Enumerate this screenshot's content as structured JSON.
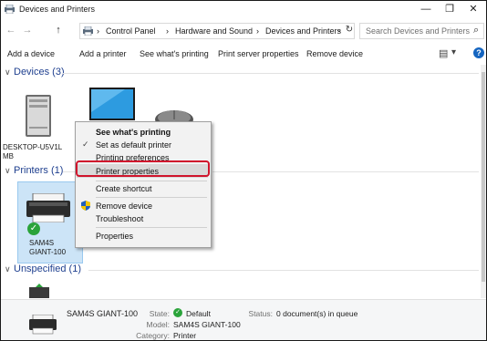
{
  "window": {
    "title": "Devices and Printers",
    "minimize": "—",
    "maximize": "❐",
    "close": "✕"
  },
  "nav": {
    "back": "←",
    "forward": "→",
    "up": "↑",
    "breadcrumbs": [
      "Control Panel",
      "Hardware and Sound",
      "Devices and Printers"
    ],
    "separator": "›",
    "dropdown": "⌄",
    "refresh": "↻",
    "search_placeholder": "Search Devices and Printers",
    "search_icon": "⌕"
  },
  "toolbar": {
    "add_device": "Add a device",
    "add_printer": "Add a printer",
    "see_printing": "See what's printing",
    "print_server": "Print server properties",
    "remove_device": "Remove device",
    "view_icon": "▤",
    "view_arrow": "▾",
    "help": "?"
  },
  "groups": {
    "devices": "Devices (3)",
    "printers": "Printers (1)",
    "unspecified": "Unspecified (1)"
  },
  "devices": {
    "desktop_label_1": "DESKTOP-U5V1L",
    "desktop_label_2": "MB"
  },
  "printer": {
    "name_line1": "SAM4S",
    "name_line2": "GIANT-100"
  },
  "context_menu": {
    "items": [
      "See what's printing",
      "Set as default printer",
      "Printing preferences",
      "Printer properties",
      "Create shortcut",
      "Remove device",
      "Troubleshoot",
      "Properties"
    ],
    "check_mark": "✓"
  },
  "details": {
    "name": "SAM4S GIANT-100",
    "state_label": "State:",
    "state_value": "Default",
    "model_label": "Model:",
    "model_value": "SAM4S GIANT-100",
    "category_label": "Category:",
    "category_value": "Printer",
    "status_label": "Status:",
    "status_value": "0 document(s) in queue"
  },
  "colors": {
    "accent": "#1e3f8f",
    "highlight_border": "#d0142c",
    "selection": "#cce4f7",
    "default_badge": "#2aa33a"
  }
}
